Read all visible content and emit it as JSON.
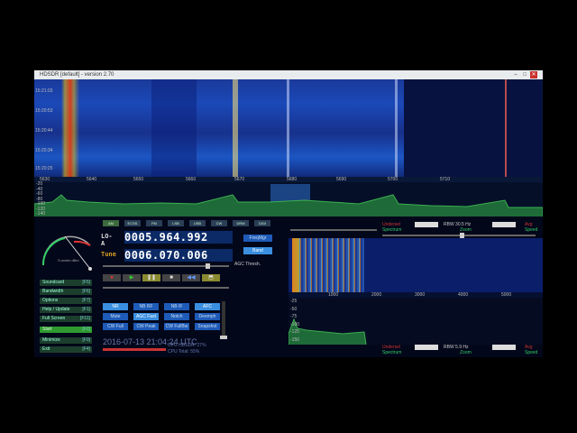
{
  "window": {
    "title": "HDSDR [default] - version 2.70"
  },
  "waterfall_labels": [
    "15:21:03",
    "15:20:53",
    "15:20:44",
    "15:20:34",
    "15:20:25"
  ],
  "scale_ticks": [
    "5630",
    "5640",
    "5650",
    "5660",
    "5670",
    "5680",
    "5690",
    "5700",
    "5710"
  ],
  "spectrum_levels": [
    "-20",
    "-40",
    "-60",
    "-80",
    "-100",
    "-120",
    "-140"
  ],
  "modes": [
    "AM",
    "ECSS",
    "FM",
    "LSB",
    "USB",
    "CW",
    "DRM",
    "DIGI"
  ],
  "vfo": {
    "lo_label": "LO-A",
    "lo_value": "0005.964.992",
    "tune_label": "Tune",
    "tune_value": "0006.070.006"
  },
  "freq_mgr": "FreqMgr",
  "band": "Band",
  "agc_thresh": "AGC Thresh.",
  "meter": {
    "label": "S-meter dBm"
  },
  "side_buttons": [
    {
      "label": "Soundcard",
      "key": "[F5]"
    },
    {
      "label": "Bandwidth",
      "key": "[F6]"
    },
    {
      "label": "Options",
      "key": "[F7]"
    },
    {
      "label": "Help / Update",
      "key": "[F1]"
    },
    {
      "label": "Full Screen",
      "key": "[F11]"
    },
    {
      "label": "Start",
      "key": "[F2]"
    },
    {
      "label": "Minimize",
      "key": "[F9]"
    },
    {
      "label": "Exit",
      "key": "[F4]"
    }
  ],
  "dsp_buttons": [
    "NR",
    "NB RF",
    "NB IF",
    "AFC",
    "Mute",
    "AGC Fast",
    "Notch",
    "Deemph",
    "CW Full",
    "CW Peak",
    "CW FullBw",
    "Snapshot"
  ],
  "player": [
    "●",
    "▶",
    "❚❚",
    "■",
    "◀◀",
    "⬒"
  ],
  "timestamp": "2016-07-13  21:04:24 UTC",
  "cpu": {
    "hdsdr": "CPU HDSDR: 27%",
    "total": "CPU Total: 55%"
  },
  "right_panel": {
    "top": {
      "undersel": "Undersel",
      "rbw": "RBW 30.5 Hz",
      "avg": "Avg",
      "spectrum": "Spectrum",
      "zoom": "Zoom",
      "speed": "Speed"
    },
    "bottom": {
      "undersel": "Undersel",
      "rbw": "RBW 5.9 Hz",
      "avg": "Avg",
      "spectrum": "Spectrum",
      "zoom": "Zoom",
      "speed": "Speed"
    },
    "zoom_ticks": [
      "1000",
      "2000",
      "3000",
      "4000",
      "5000"
    ],
    "zoom_levels": [
      "-25",
      "-50",
      "-75",
      "-100",
      "-125",
      "-150"
    ]
  },
  "colors": {
    "accent": "#1e5bb8",
    "vfo_bg": "#0b2a66",
    "red_label": "#c33"
  },
  "icons": [
    "minimize-icon",
    "maximize-icon",
    "close-icon",
    "record-icon",
    "play-icon",
    "pause-icon",
    "stop-icon",
    "rewind-icon",
    "loop-icon"
  ]
}
